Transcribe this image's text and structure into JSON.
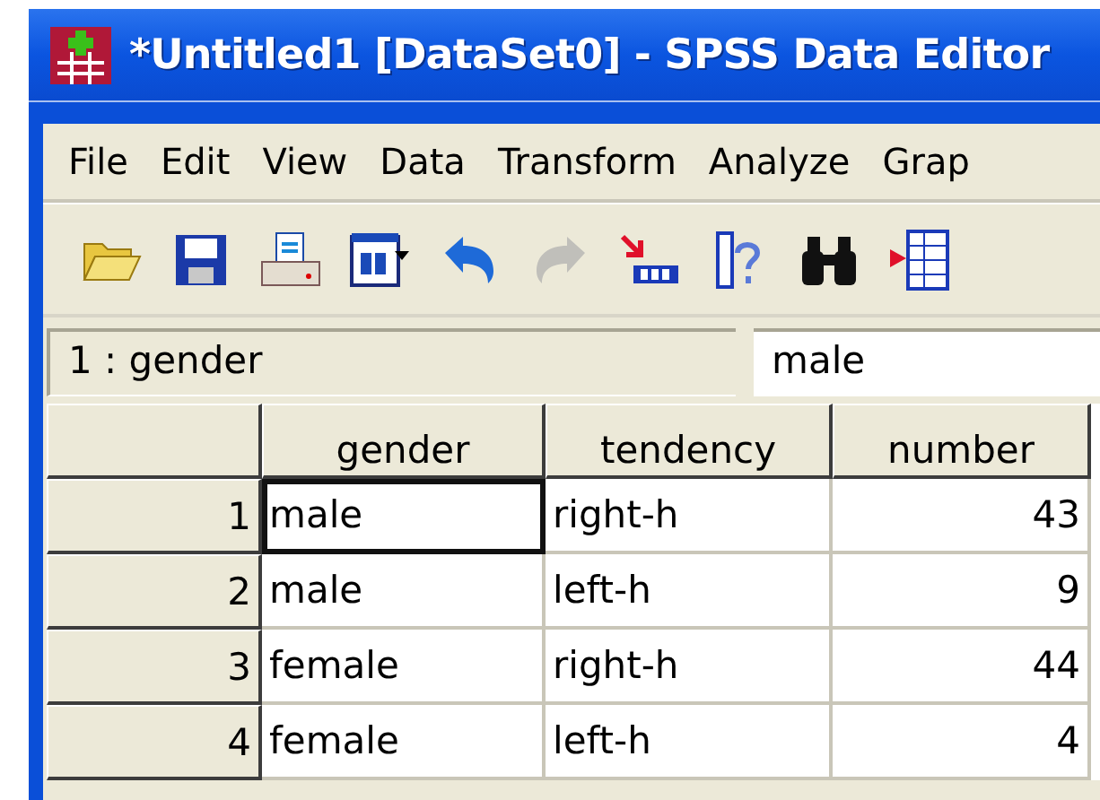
{
  "window": {
    "title": "*Untitled1 [DataSet0] - SPSS Data Editor"
  },
  "menu": [
    "File",
    "Edit",
    "View",
    "Data",
    "Transform",
    "Analyze",
    "Grap"
  ],
  "toolbar": [
    {
      "kind": "open",
      "disabled": false
    },
    {
      "kind": "save",
      "disabled": false
    },
    {
      "kind": "print",
      "disabled": false
    },
    {
      "kind": "dialog",
      "disabled": false
    },
    {
      "kind": "undo",
      "disabled": false
    },
    {
      "kind": "redo",
      "disabled": true
    },
    {
      "kind": "goto",
      "disabled": false
    },
    {
      "kind": "variables",
      "disabled": false
    },
    {
      "kind": "find",
      "disabled": false
    },
    {
      "kind": "insert",
      "disabled": false
    }
  ],
  "cell_info": {
    "reference": "1 : gender",
    "value": "male"
  },
  "table": {
    "columns": [
      "gender",
      "tendency",
      "number"
    ],
    "rows": [
      {
        "label": "1",
        "cells": [
          {
            "text": "male",
            "selected": true
          },
          {
            "text": "right-h",
            "selected": false
          },
          {
            "text": "43",
            "selected": false
          }
        ]
      },
      {
        "label": "2",
        "cells": [
          {
            "text": "male",
            "selected": false
          },
          {
            "text": "left-h",
            "selected": false
          },
          {
            "text": "9",
            "selected": false
          }
        ]
      },
      {
        "label": "3",
        "cells": [
          {
            "text": "female",
            "selected": false
          },
          {
            "text": "right-h",
            "selected": false
          },
          {
            "text": "44",
            "selected": false
          }
        ]
      },
      {
        "label": "4",
        "cells": [
          {
            "text": "female",
            "selected": false
          },
          {
            "text": "left-h",
            "selected": false
          },
          {
            "text": "4",
            "selected": false
          }
        ]
      }
    ]
  }
}
